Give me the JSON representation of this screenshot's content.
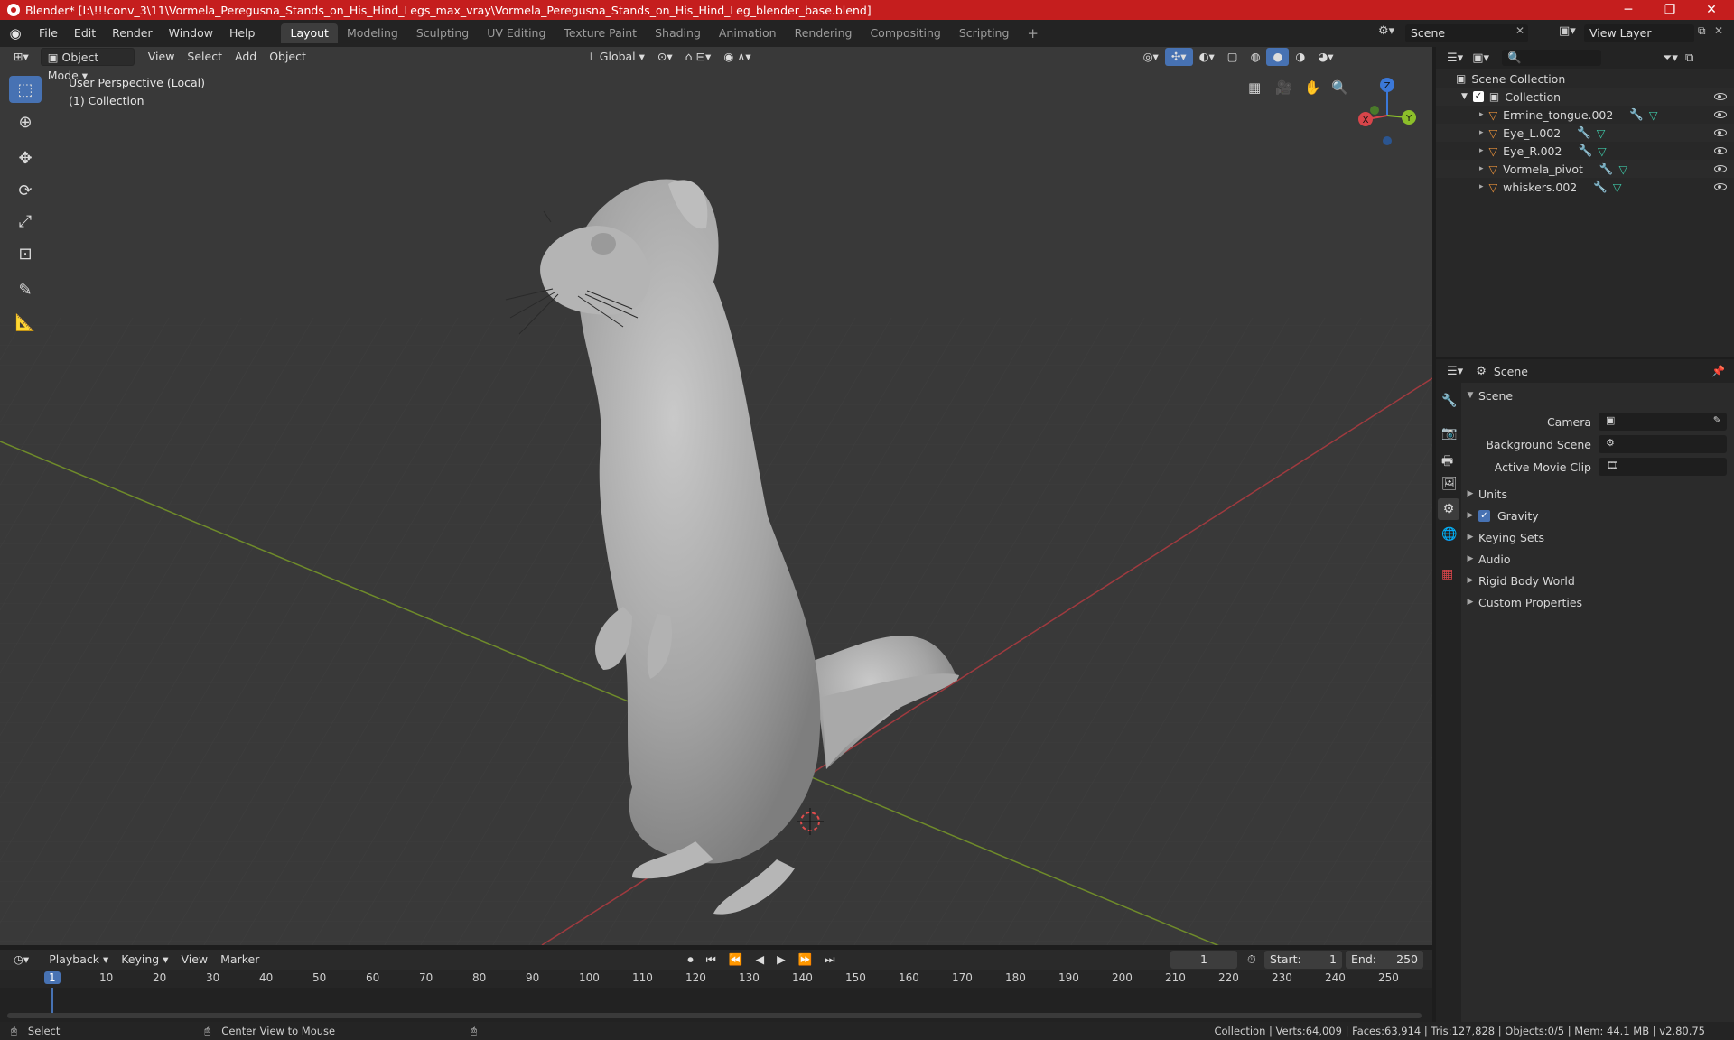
{
  "window": {
    "title": "Blender* [I:\\!!!conv_3\\11\\Vormela_Peregusna_Stands_on_His_Hind_Legs_max_vray\\Vormela_Peregusna_Stands_on_His_Hind_Leg_blender_base.blend]",
    "minimize": "─",
    "maximize": "❐",
    "close": "✕"
  },
  "menu": [
    "File",
    "Edit",
    "Render",
    "Window",
    "Help"
  ],
  "workspaces": [
    "Layout",
    "Modeling",
    "Sculpting",
    "UV Editing",
    "Texture Paint",
    "Shading",
    "Animation",
    "Rendering",
    "Compositing",
    "Scripting"
  ],
  "workspace_add": "+",
  "scene_field": "Scene",
  "view_layer_field": "View Layer",
  "viewport": {
    "mode": "Object Mode",
    "menus": [
      "View",
      "Select",
      "Add",
      "Object"
    ],
    "transform_orientation": "Global",
    "overlay_line1": "User Perspective (Local)",
    "overlay_line2": "(1) Collection",
    "gizmo": {
      "z": "Z",
      "y": "Y",
      "x": "X"
    }
  },
  "outliner": {
    "search_placeholder": "",
    "root": "Scene Collection",
    "collection": "Collection",
    "objects": [
      "Ermine_tongue.002",
      "Eye_L.002",
      "Eye_R.002",
      "Vormela_pivot",
      "whiskers.002"
    ]
  },
  "properties": {
    "context": "Scene",
    "panel": "Scene",
    "fields": [
      {
        "label": "Camera"
      },
      {
        "label": "Background Scene"
      },
      {
        "label": "Active Movie Clip"
      }
    ],
    "sections": [
      "Units",
      "Gravity",
      "Keying Sets",
      "Audio",
      "Rigid Body World",
      "Custom Properties"
    ],
    "gravity_checked": true
  },
  "timeline": {
    "menus": [
      "Playback",
      "Keying",
      "View",
      "Marker"
    ],
    "current_frame": "1",
    "start_label": "Start:",
    "start": "1",
    "end_label": "End:",
    "end": "250",
    "ruler": [
      "1",
      "10",
      "20",
      "30",
      "40",
      "50",
      "60",
      "70",
      "80",
      "90",
      "100",
      "110",
      "120",
      "130",
      "140",
      "150",
      "160",
      "170",
      "180",
      "190",
      "200",
      "210",
      "220",
      "230",
      "240",
      "250"
    ]
  },
  "status": {
    "left_action": "Select",
    "middle_action": "Center View to Mouse",
    "stats": "Collection | Verts:64,009 | Faces:63,914 | Tris:127,828 | Objects:0/5 | Mem: 44.1 MB | v2.80.75"
  },
  "colors": {
    "accent": "#4772b3",
    "title_bar": "#c51e1e",
    "axis_x": "#d8454a",
    "axis_y": "#8cbf2a",
    "axis_z": "#3b78d8",
    "object_icon": "#e8913a",
    "modifier_icon": "#6ea3e6",
    "mesh_icon": "#3ec6a5"
  }
}
